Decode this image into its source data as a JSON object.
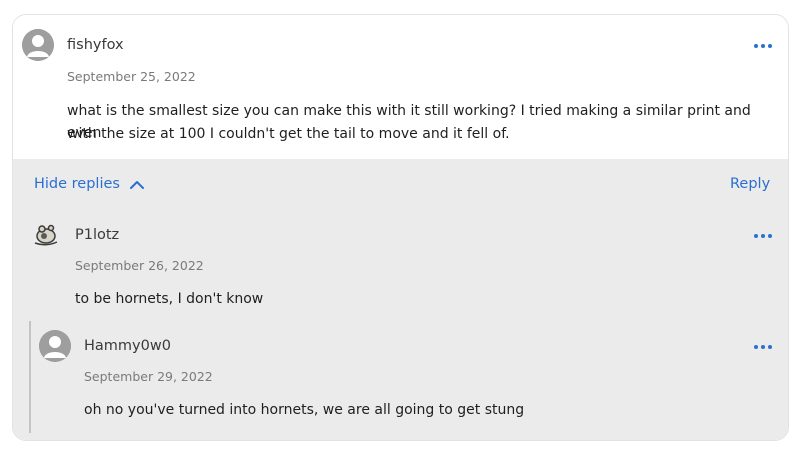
{
  "comment": {
    "username": "fishyfox",
    "date": "September 25, 2022",
    "text_line1": "what is the smallest size you can make this with it still working? I tried making a similar print and even",
    "text_line2": "with the size at 100 I couldn't get the tail to move and it fell of."
  },
  "actions": {
    "hide_replies": "Hide replies",
    "reply": "Reply"
  },
  "replies": [
    {
      "username": "P1lotz",
      "date": "September 26, 2022",
      "text": "to be hornets, I don't know"
    },
    {
      "username": "Hammy0w0",
      "date": "September 29, 2022",
      "text": "oh no you've turned into hornets, we are all going to get stung"
    }
  ],
  "colors": {
    "accent": "#2b6fd1",
    "reply_background": "#ebebeb"
  },
  "icons": {
    "default_avatar": "user-silhouette-icon",
    "more": "more-horizontal-icon",
    "collapse": "chevron-up-icon"
  }
}
